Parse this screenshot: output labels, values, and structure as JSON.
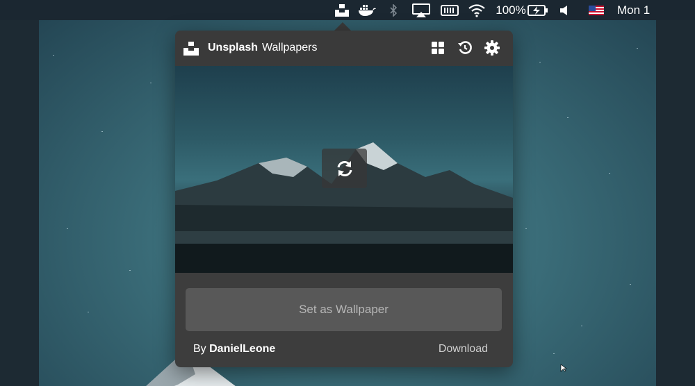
{
  "menubar": {
    "battery_percent": "100%",
    "clock": "Mon 1",
    "icons": [
      "unsplash-icon",
      "docker-icon",
      "bluetooth-icon",
      "airplay-icon",
      "memory-icon",
      "wifi-icon",
      "battery-charging-icon",
      "volume-icon",
      "us-flag-icon"
    ]
  },
  "popover": {
    "app_name": "Unsplash",
    "app_subtitle": "Wallpapers",
    "header_icons": [
      "grid-icon",
      "history-icon",
      "gear-icon"
    ],
    "refresh_icon": "refresh-icon",
    "set_wallpaper_label": "Set as Wallpaper",
    "credit_prefix": "By",
    "credit_author": "DanielLeone",
    "download_label": "Download"
  },
  "colors": {
    "menubar_bg": "#1b2731",
    "popover_bg": "#3d3d3d",
    "button_bg": "#585858",
    "button_text": "#b7b7b7",
    "wallpaper_accent": "#3a6c78"
  }
}
